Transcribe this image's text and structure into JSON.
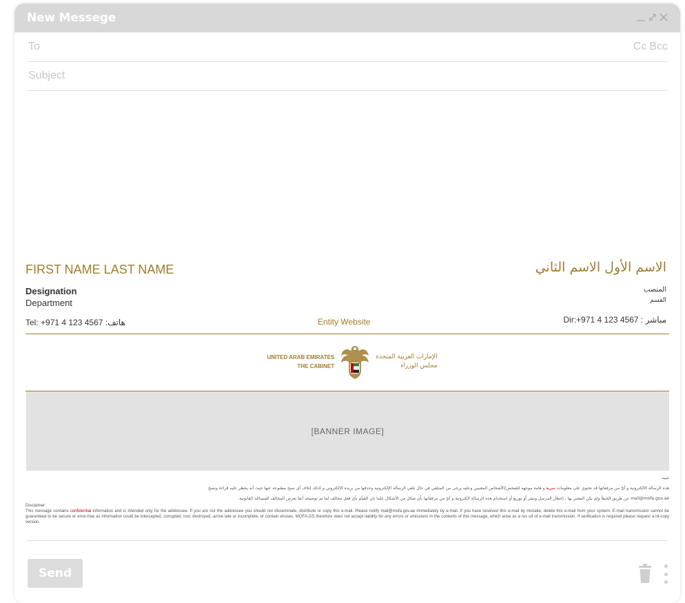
{
  "window": {
    "title": "New Messege",
    "controls": [
      "minimize-icon",
      "expand-icon",
      "close-icon"
    ]
  },
  "compose": {
    "to_placeholder": "To",
    "cc_label": "Cc",
    "bcc_label": "Bcc",
    "subject_placeholder": "Subject"
  },
  "signature": {
    "name_en": "FIRST NAME LAST NAME",
    "name_ar": "الاسم الأول الاسم الثاني",
    "designation": "Designation",
    "department": "Department",
    "designation_ar": "المنصب",
    "department_ar": "القسم",
    "tel": "Tel: +971 4 123 4567 :هاتف",
    "website": "Entity Website",
    "dir": "Dir:+971 4 123 4567 : مباشر",
    "logo_en_line1": "UNITED ARAB EMIRATES",
    "logo_en_line2": "THE CABINET",
    "logo_ar_line1": "الإمارات العربية المتحدة",
    "logo_ar_line2": "مجلس الوزراء",
    "banner": "[BANNER IMAGE]",
    "accent_color": "#a07d2d"
  },
  "disclaimer": {
    "ar_heading": "تنبيه:",
    "ar_line1_pre": "هذه الرسالة الالكترونية و أيّ من مرفقاتها قد تحتوي على معلومات ",
    "ar_line1_red": "سرية",
    "ar_line1_post": " و هامة موجهه للشخص/الأشخاص المعنيين وعليه يرجى من المتلقي في حال تلقي الرسالة الإلكترونية وحذفها من بريده الإلكتروني و كذلك إتلاف أي نسخ مطبوعة عنها حيث أنه يحظر عليه قراءة ونسخ",
    "ar_line2": "mail@mofa.gov.ae عن طريق الخطأ ولم يكن المعني بها ، إخطار المرسل ونشر أو توزيع أو استخدام هذه الرسالة الكترونية و أيّ من مرفقاتها بأي شكل من الأشكال علما بان القيام بأي فعل مخالف لما تم توضيحه أنفا يعرض المخالف للمسائلة القانونية.",
    "en_heading": "Disclaimer:",
    "en_pre": "This message contains ",
    "en_red": "confidential",
    "en_post": " information and is intended only for the addressee. If you are not the addressee you should not disseminate, distribute or copy this e-mail. Please notify mail@mofa.gov.ae immediately by e-mail. If you have received this e-mail by mistake, delete this e-mail from your system. E-mail transmission cannot be guaranteed to be secure or error-free as information could be intercepted, corrupted, lost, destroyed, arrive late or incomplete, or contain viruses. MOFA-GS therefore does not accept liability for any errors or omissions in the contents of this message, which arise as a res ult of e-mail transmission. If verification is required please request a rd-copy version."
  },
  "footer": {
    "send_label": "Send",
    "trash_icon": "trash-icon",
    "more_icon": "more-vertical-icon"
  }
}
